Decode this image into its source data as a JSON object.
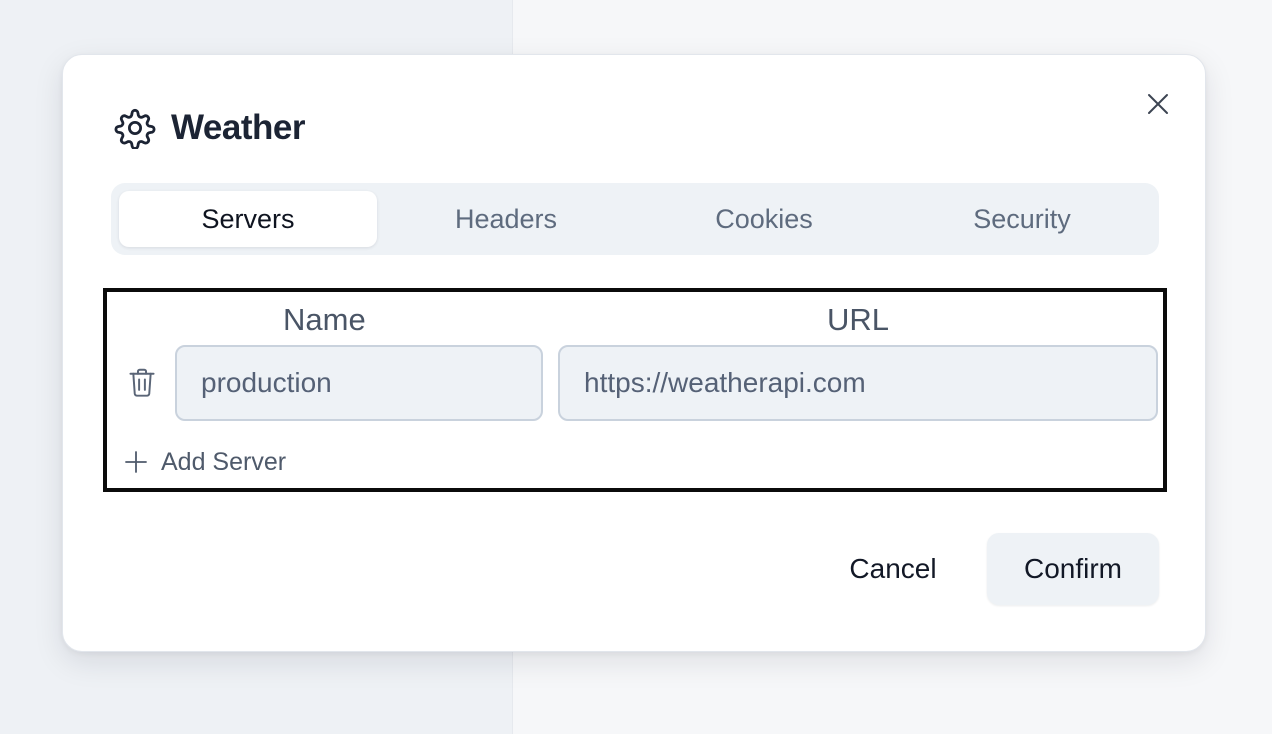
{
  "dialog": {
    "title": "Weather",
    "icon": "gear-icon",
    "close_icon": "close-icon"
  },
  "tabs": [
    {
      "label": "Servers",
      "active": true
    },
    {
      "label": "Headers",
      "active": false
    },
    {
      "label": "Cookies",
      "active": false
    },
    {
      "label": "Security",
      "active": false
    }
  ],
  "servers": {
    "columns": {
      "name": "Name",
      "url": "URL"
    },
    "rows": [
      {
        "name": "production",
        "url": "https://weatherapi.com"
      }
    ],
    "add_label": "Add Server"
  },
  "footer": {
    "cancel_label": "Cancel",
    "confirm_label": "Confirm"
  },
  "colors": {
    "active_tab_bg": "#ffffff",
    "tab_bar_bg": "#eef2f6",
    "input_bg": "#eef2f6",
    "input_border": "#c9d2dd",
    "highlight_border": "#0b0b0b",
    "title_text": "#1c2434"
  }
}
